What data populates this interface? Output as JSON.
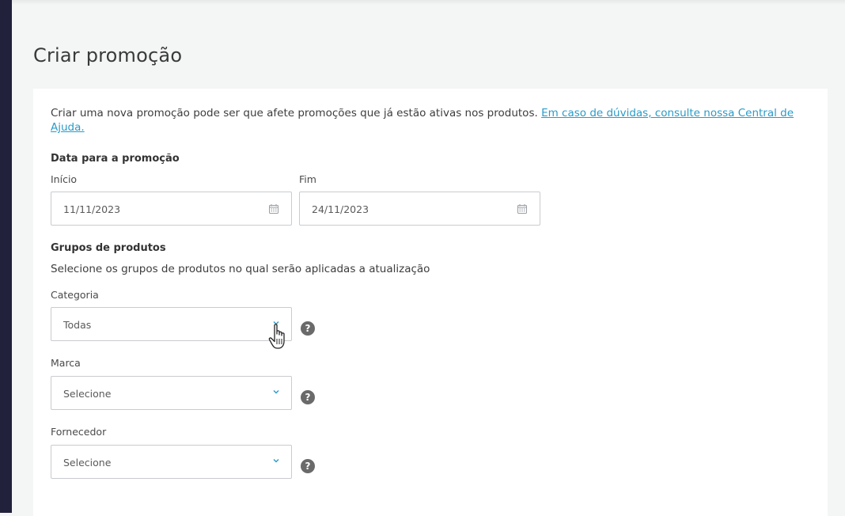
{
  "page": {
    "title": "Criar promoção"
  },
  "intro": {
    "text": "Criar uma nova promoção pode ser que afete promoções que já estão ativas nos produtos. ",
    "link": "Em caso de dúvidas, consulte nossa Central de Ajuda."
  },
  "dates": {
    "section_title": "Data para a promoção",
    "start": {
      "label": "Início",
      "value": "11/11/2023",
      "icon": "calendar-icon"
    },
    "end": {
      "label": "Fim",
      "value": "24/11/2023",
      "icon": "calendar-icon"
    }
  },
  "groups": {
    "section_title": "Grupos de produtos",
    "description": "Selecione os grupos de produtos no qual serão aplicadas a atualização",
    "category": {
      "label": "Categoria",
      "value": "Todas"
    },
    "brand": {
      "label": "Marca",
      "value": "Selecione"
    },
    "supplier": {
      "label": "Fornecedor",
      "value": "Selecione"
    },
    "help_symbol": "?"
  },
  "colors": {
    "sidebar": "#22213c",
    "link": "#2a9bc8",
    "chevron": "#2a9bc8",
    "help_icon": "#6a6a6a"
  }
}
